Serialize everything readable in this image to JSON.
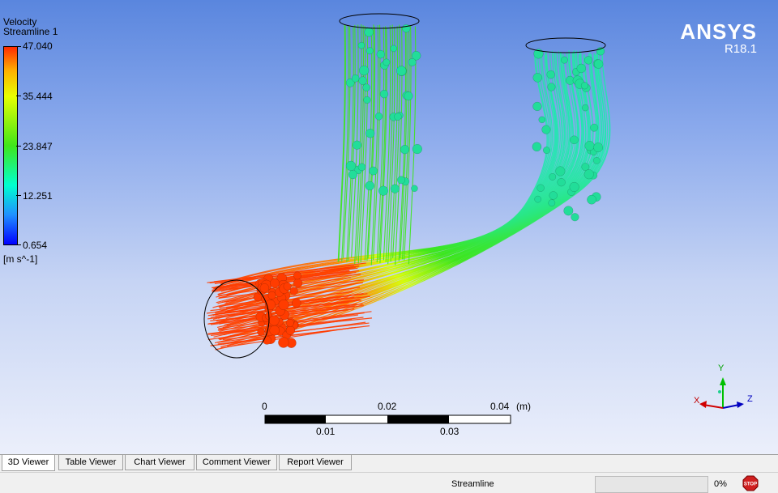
{
  "legend": {
    "variable": "Velocity",
    "object": "Streamline 1",
    "values": [
      "47.040",
      "35.444",
      "23.847",
      "12.251",
      "0.654"
    ],
    "unit": "[m s^-1]"
  },
  "brand": {
    "name": "ANSYS",
    "version": "R18.1"
  },
  "scale_bar": {
    "top_labels": [
      "0",
      "0.02",
      "0.04"
    ],
    "bottom_labels": [
      "0.01",
      "0.03"
    ],
    "unit": "(m)"
  },
  "axes": {
    "x": "X",
    "y": "Y",
    "z": "Z"
  },
  "tabs": [
    "3D Viewer",
    "Table Viewer",
    "Chart Viewer",
    "Comment Viewer",
    "Report Viewer"
  ],
  "active_tab": "3D Viewer",
  "status": {
    "text": "Streamline",
    "progress": 0,
    "progress_text": "0%",
    "stop_label": "STOP"
  },
  "colors": {
    "high": "#ff3c00",
    "mid": "#3ce61a",
    "low": "#20e8b0",
    "particle": "#22dd99"
  }
}
